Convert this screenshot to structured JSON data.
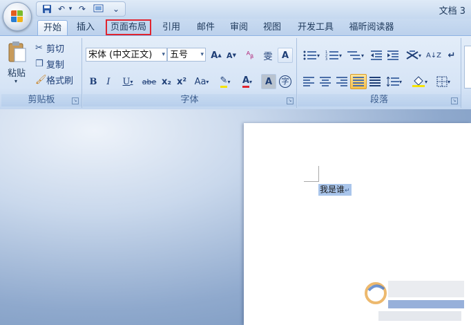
{
  "window": {
    "title": "文档 3"
  },
  "qat": {
    "save": "save-icon",
    "undo": "↶",
    "undo_dd": "▾",
    "redo": "↷",
    "print_preview": "print-preview-icon",
    "customize": "⌄"
  },
  "tabs": [
    {
      "label": "开始",
      "active": true
    },
    {
      "label": "插入"
    },
    {
      "label": "页面布局",
      "highlighted": true
    },
    {
      "label": "引用"
    },
    {
      "label": "邮件"
    },
    {
      "label": "审阅"
    },
    {
      "label": "视图"
    },
    {
      "label": "开发工具"
    },
    {
      "label": "福昕阅读器"
    }
  ],
  "clipboard": {
    "paste": "粘贴",
    "cut": "剪切",
    "copy": "复制",
    "format_painter": "格式刷",
    "group": "剪贴板"
  },
  "font": {
    "name": "宋体 (中文正文)",
    "size": "五号",
    "group": "字体",
    "grow": "A",
    "shrink": "A",
    "clear": "ᴬᵦ",
    "phonetic": "雯",
    "border": "A",
    "bold": "B",
    "italic": "I",
    "underline": "U",
    "strike": "abe",
    "sub": "x₂",
    "sup": "x²",
    "case": "Aa",
    "highlight": "✎",
    "color": "A",
    "shading": "A",
    "enclose": "字"
  },
  "paragraph": {
    "group": "段落",
    "sort": "A↓Z",
    "marks": "↵"
  },
  "document": {
    "text": "我是谁"
  },
  "colors": {
    "accent": "#e0242f",
    "selection": "#a9c5eb",
    "ribbon": "#d6e4f6"
  }
}
